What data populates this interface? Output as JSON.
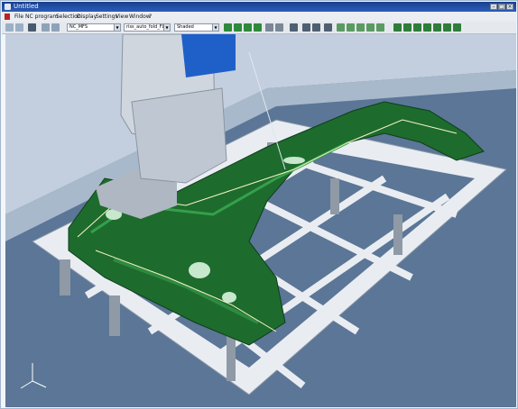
{
  "window": {
    "title": "Untitled",
    "minimize_glyph": "–",
    "maximize_glyph": "□",
    "close_glyph": "×"
  },
  "menu": {
    "items": [
      "File",
      "NC program",
      "Selection",
      "Display",
      "Settings",
      "View",
      "Window",
      "?"
    ]
  },
  "toolbar": {
    "program_select": {
      "value": "NC_MFS"
    },
    "setup_select": {
      "value": "riss_auto_fold_FLA"
    },
    "display_select": {
      "value": "Shaded"
    },
    "icons": [
      "back-arrow-icon",
      "forward-arrow-icon",
      "save-icon",
      "undo-icon",
      "redo-icon",
      "rotate-icon",
      "zoom-icon",
      "pan-icon",
      "fit-icon",
      "shade-icon",
      "wire-icon",
      "axis-icon",
      "tool-icon",
      "ruler-icon",
      "grid-icon"
    ]
  },
  "viewport": {
    "scene": "3d-machining-simulation",
    "colors": {
      "floor": "#5b7696",
      "wall": "#c3cfde",
      "fixture": "#e9edf2",
      "part": "#1e6b2e",
      "spindle": "#cfd6de",
      "head_block": "#1f5fc8"
    }
  }
}
